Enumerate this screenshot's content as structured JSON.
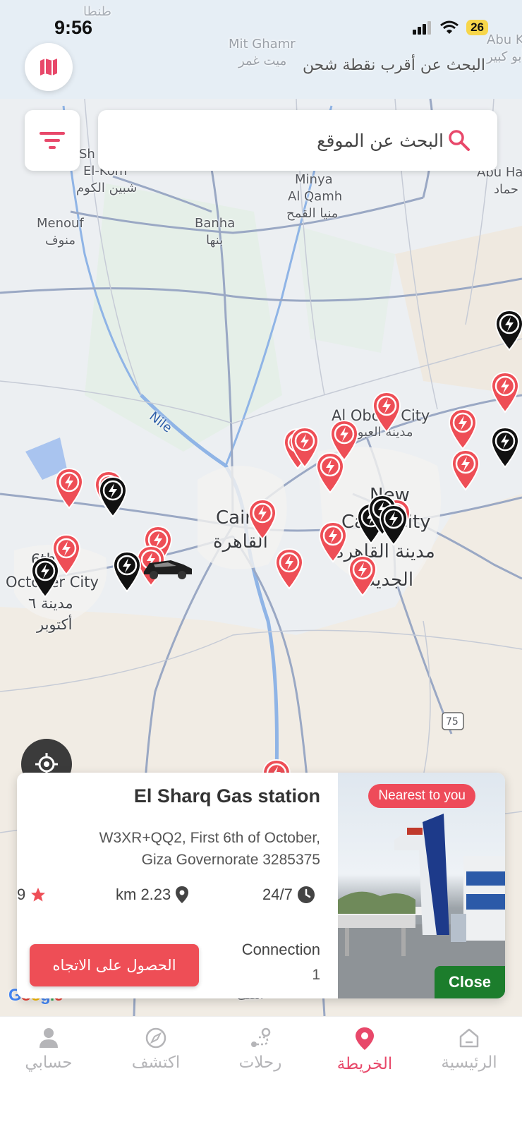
{
  "status_bar": {
    "time": "9:56",
    "battery": "26"
  },
  "map": {
    "top_hint": "البحث عن أقرب نقطة شحن",
    "labels": [
      {
        "text": "طنطا"
      },
      {
        "text": "Mit Ghamr"
      },
      {
        "text": "ميت غمر"
      },
      {
        "text": "Abu K"
      },
      {
        "text": "أبو كبير"
      },
      {
        "text": "Sh"
      },
      {
        "text": "El-Kom"
      },
      {
        "text": "شبين الكوم"
      },
      {
        "text": "Minya"
      },
      {
        "text": "Al Qamh"
      },
      {
        "text": "منيا القمح"
      },
      {
        "text": "Abu Ha"
      },
      {
        "text": "حماد"
      },
      {
        "text": "Menouf"
      },
      {
        "text": "منوف"
      },
      {
        "text": "Banha"
      },
      {
        "text": "بنها"
      },
      {
        "text": "Nile"
      },
      {
        "text": "Al Obour City"
      },
      {
        "text": "مدينة العبور"
      },
      {
        "text": "Cairo"
      },
      {
        "text": "القاهرة"
      },
      {
        "text": "New"
      },
      {
        "text": "Cairo City"
      },
      {
        "text": "مدينة القاهرة"
      },
      {
        "text": "الجديدة"
      },
      {
        "text": "6th of"
      },
      {
        "text": "October City"
      },
      {
        "text": "مدينة ٦"
      },
      {
        "text": "أكتوبر"
      },
      {
        "text": "75"
      },
      {
        "text": "الصف"
      }
    ],
    "google": "Google"
  },
  "search": {
    "placeholder": "البحث عن الموقع"
  },
  "station_card": {
    "title": "El Sharq Gas station",
    "address_line1": "W3XR+QQ2, First 6th of October,",
    "address_line2": "Giza Governorate 3285375",
    "rating": "9",
    "distance": "km 2.23",
    "hours": "24/7",
    "connection_label": "Connection",
    "connection_value": "1",
    "directions_button": "الحصول على الاتجاه",
    "badge": "Nearest to you",
    "close_button": "Close",
    "accent_color": "#ee4e56"
  },
  "bottom_nav": {
    "items": [
      {
        "label": "حسابي",
        "icon": "person-icon",
        "active": false
      },
      {
        "label": "اكتشف",
        "icon": "compass-icon",
        "active": false
      },
      {
        "label": "رحلات",
        "icon": "route-icon",
        "active": false
      },
      {
        "label": "الخريطة",
        "icon": "map-pin-icon",
        "active": true
      },
      {
        "label": "الرئيسية",
        "icon": "home-icon",
        "active": false
      }
    ],
    "active_color": "#e8486a",
    "inactive_color": "#b5b5b8"
  }
}
